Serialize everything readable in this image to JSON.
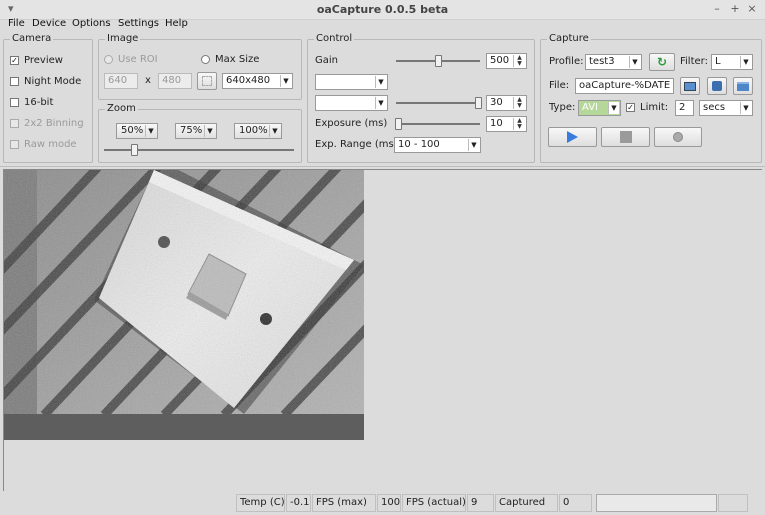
{
  "window": {
    "title": "oaCapture 0.0.5 beta"
  },
  "menu": [
    "File",
    "Device",
    "Options",
    "Settings",
    "Help"
  ],
  "camera": {
    "label": "Camera",
    "options": [
      {
        "label": "Preview",
        "checked": true,
        "disabled": false
      },
      {
        "label": "Night Mode",
        "checked": false,
        "disabled": false
      },
      {
        "label": "16-bit",
        "checked": false,
        "disabled": false
      },
      {
        "label": "2x2 Binning",
        "checked": false,
        "disabled": true
      },
      {
        "label": "Raw mode",
        "checked": false,
        "disabled": true
      }
    ]
  },
  "image": {
    "label": "Image",
    "use_roi": "Use ROI",
    "max_size": "Max Size",
    "width": "640",
    "x": "x",
    "height": "480",
    "resolution": "640x480"
  },
  "zoom": {
    "label": "Zoom",
    "levels": [
      "50%",
      "75%",
      "100%"
    ],
    "slider_level": 0.15
  },
  "control": {
    "label": "Control",
    "gain_label": "Gain",
    "gain_value": "500",
    "gain_level": 0.5,
    "control2_value": "30",
    "control2_level": 1.0,
    "exposure_label": "Exposure (ms)",
    "exposure_value": "10",
    "exposure_level": 0.0,
    "exp_range_label": "Exp. Range (ms)",
    "exp_range_value": "10 - 100"
  },
  "capture": {
    "label": "Capture",
    "profile_label": "Profile:",
    "profile_value": "test3",
    "filter_label": "Filter:",
    "filter_value": "L",
    "file_label": "File:",
    "file_value": "oaCapture-%DATE",
    "type_label": "Type:",
    "type_value": "AVI",
    "limit_label": "Limit:",
    "limit_checked": true,
    "limit_value": "2",
    "limit_unit": "secs"
  },
  "status": {
    "temp_label": "Temp (C)",
    "temp_value": "-0.1",
    "fps_max_label": "FPS (max)",
    "fps_max_value": "100",
    "fps_actual_label": "FPS (actual)",
    "fps_actual_value": "9",
    "captured_label": "Captured",
    "captured_value": "0"
  }
}
